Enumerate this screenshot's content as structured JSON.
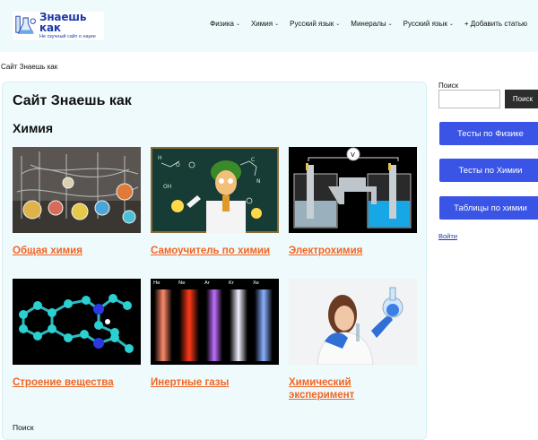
{
  "header": {
    "logo_title": "Знаешь как",
    "logo_subtitle": "Не скучный сайт о науке",
    "nav": [
      {
        "label": "Физика",
        "has_dropdown": true
      },
      {
        "label": "Химия",
        "has_dropdown": true
      },
      {
        "label": "Русский язык",
        "has_dropdown": true
      },
      {
        "label": "Минералы",
        "has_dropdown": true
      },
      {
        "label": "Русский язык",
        "has_dropdown": true
      },
      {
        "label": "+ Добавить статью",
        "has_dropdown": false
      }
    ],
    "chevron": "⌄"
  },
  "breadcrumb": "Сайт Знаешь как",
  "main": {
    "title": "Сайт Знаешь как",
    "section": "Химия",
    "cards": [
      {
        "label": "Общая химия",
        "image": "glassware-image"
      },
      {
        "label": "Самоучитель по химии",
        "image": "scientist-cartoon-image"
      },
      {
        "label": "Электрохимия",
        "image": "electrolysis-image"
      },
      {
        "label": "Строение вещества",
        "image": "molecule-image"
      },
      {
        "label": "Инертные газы",
        "image": "noble-gas-tubes-image"
      },
      {
        "label": "Химический эксперимент",
        "image": "chemist-experiment-image"
      }
    ],
    "search_label": "Поиск"
  },
  "sidebar": {
    "search_label": "Поиск",
    "search_value": "",
    "search_button": "Поиск",
    "buttons": [
      {
        "label": "Тесты по Физике"
      },
      {
        "label": "Тесты по Химии"
      },
      {
        "label": "Таблицы по химии"
      }
    ],
    "login": "Войти"
  },
  "colors": {
    "accent_link": "#f26522",
    "sidebar_button": "#3a55e6",
    "panel_bg": "#eefafc",
    "search_button": "#2d2d2d"
  }
}
